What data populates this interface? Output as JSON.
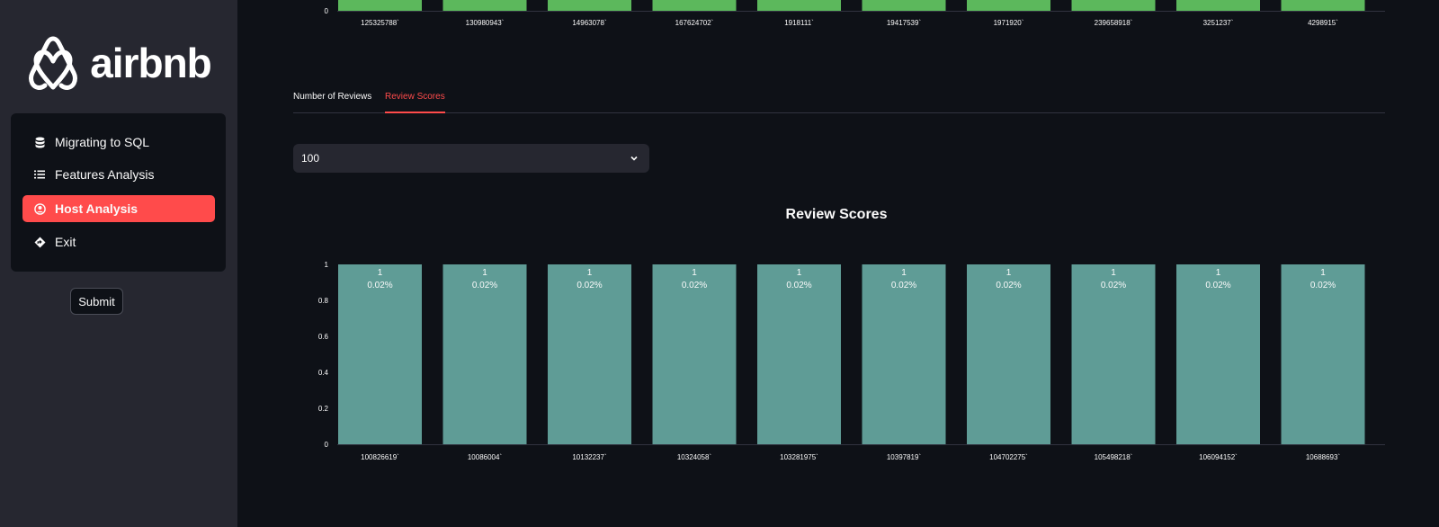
{
  "sidebar": {
    "logo_text": "airbnb",
    "menu": [
      {
        "label": "Migrating to SQL",
        "icon": "database-icon",
        "active": false
      },
      {
        "label": "Features Analysis",
        "icon": "list-icon",
        "active": false
      },
      {
        "label": "Host Analysis",
        "icon": "person-circle-icon",
        "active": true
      },
      {
        "label": "Exit",
        "icon": "diamond-sign-icon",
        "active": false
      }
    ],
    "submit_label": "Submit"
  },
  "tabs": [
    {
      "label": "Number of Reviews",
      "active": false
    },
    {
      "label": "Review Scores",
      "active": true
    }
  ],
  "select": {
    "value": "100"
  },
  "colors": {
    "brand": "#ff5a5f",
    "active_menu": "#ff4b4b",
    "top_bars": "#5cb85c",
    "review_bars": "#5f9c96",
    "background": "#0e1117",
    "sidebar": "#262730"
  },
  "chart_data": [
    {
      "type": "bar",
      "title": "",
      "categories": [
        "125325788`",
        "130980943`",
        "14963078`",
        "167624702`",
        "1918111`",
        "19417539`",
        "1971920`",
        "239658918`",
        "3251237`",
        "4298915`"
      ],
      "y_tick_labels": [
        "0"
      ],
      "color": "#5cb85c"
    },
    {
      "type": "bar",
      "title": "Review Scores",
      "categories": [
        "100826619`",
        "10086004`",
        "10132237`",
        "10324058`",
        "103281975`",
        "10397819`",
        "104702275`",
        "105498218`",
        "106094152`",
        "10688693`"
      ],
      "values": [
        1,
        1,
        1,
        1,
        1,
        1,
        1,
        1,
        1,
        1
      ],
      "data_labels": [
        "0.02%",
        "0.02%",
        "0.02%",
        "0.02%",
        "0.02%",
        "0.02%",
        "0.02%",
        "0.02%",
        "0.02%",
        "0.02%"
      ],
      "ylim": [
        0,
        1
      ],
      "y_ticks": [
        0,
        0.2,
        0.4,
        0.6,
        0.8,
        1
      ],
      "color": "#5f9c96"
    }
  ]
}
